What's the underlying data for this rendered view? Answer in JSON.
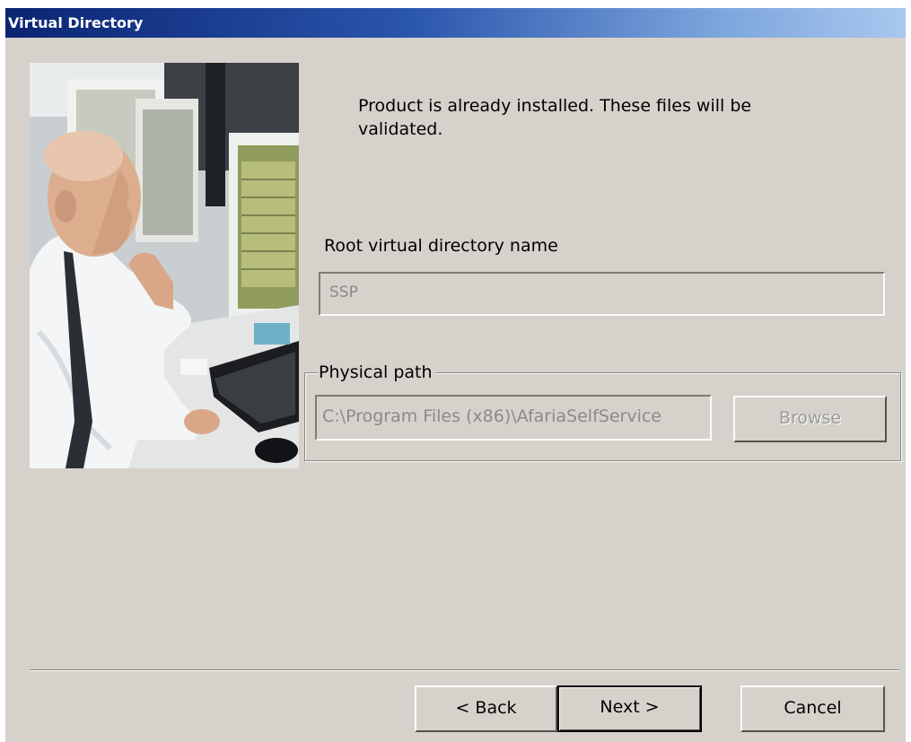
{
  "window": {
    "title": "Virtual Directory"
  },
  "message": "Product is already installed.  These files will be validated.",
  "root_directory": {
    "label": "Root virtual directory name",
    "value": "SSP"
  },
  "physical_path": {
    "group_label": "Physical path",
    "value": "C:\\Program Files (x86)\\AfariaSelfService",
    "browse_label": "Browse"
  },
  "buttons": {
    "back": "< Back",
    "next": "Next >",
    "cancel": "Cancel"
  },
  "colors": {
    "dialog_background": "#d6d2cb",
    "titlebar_start": "#0b2472",
    "titlebar_end": "#a9c7ee",
    "disabled_text": "#8a8a8a"
  }
}
